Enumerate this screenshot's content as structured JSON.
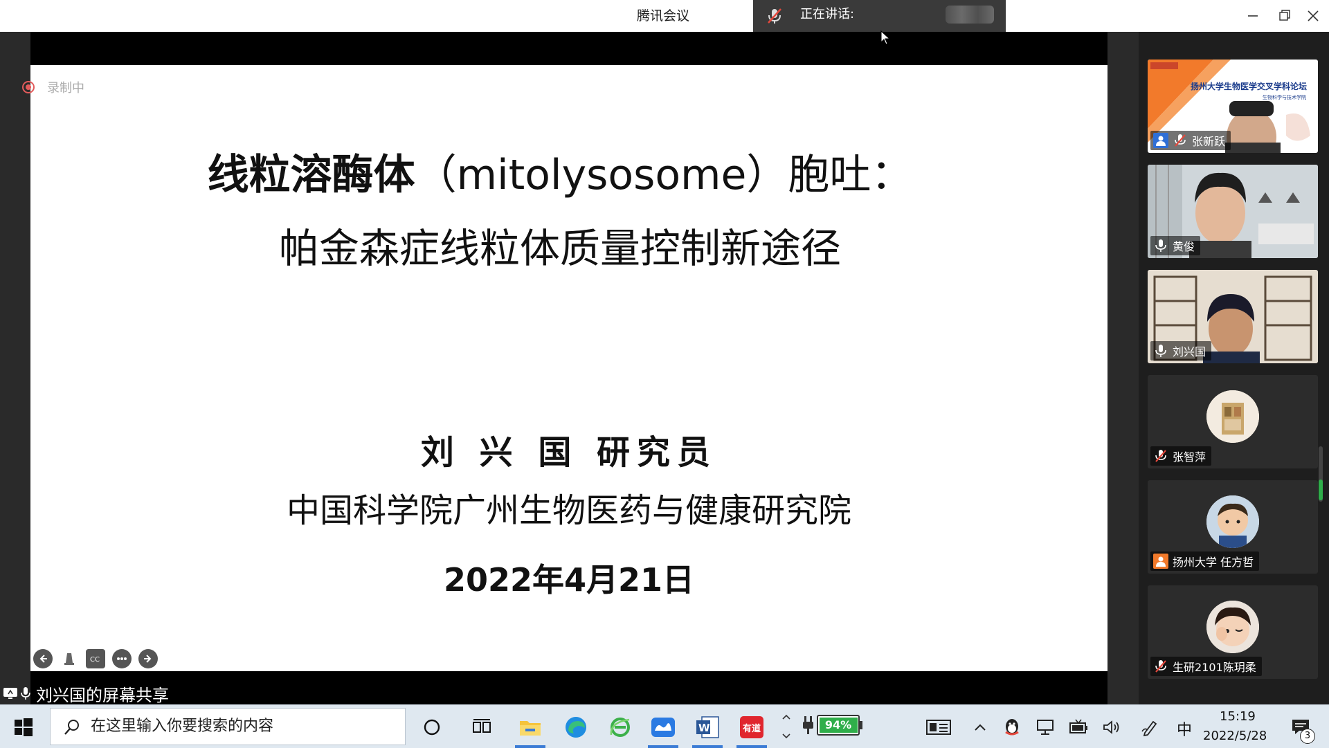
{
  "window": {
    "app_title": "腾讯会议",
    "speaking_label": "正在讲话:"
  },
  "recording": {
    "label": "录制中"
  },
  "slide": {
    "title_bold": "线粒溶酶体",
    "title_rest": "（mitolysosome）胞吐：",
    "subtitle": "帕金森症线粒体质量控制新途径",
    "author": "刘 兴 国  研究员",
    "institution": "中国科学院广州生物医药与健康研究院",
    "date": "2022年4月21日"
  },
  "share": {
    "label": "刘兴国的屏幕共享"
  },
  "participants": [
    {
      "name": "张新跃",
      "banner_title": "扬州大学生物医学交叉学科论坛",
      "banner_sub": "生物科学与技术学院",
      "mic": "muted"
    },
    {
      "name": "黄俊",
      "mic": "on"
    },
    {
      "name": "刘兴国",
      "mic": "on"
    },
    {
      "name": "张智萍",
      "mic": "muted"
    },
    {
      "name": "扬州大学 任方哲",
      "mic": "none"
    },
    {
      "name": "生研2101陈玥柔",
      "mic": "muted"
    }
  ],
  "taskbar": {
    "search_placeholder": "在这里输入你要搜索的内容",
    "battery": "94%",
    "ime": "中",
    "time": "15:19",
    "date": "2022/5/28",
    "notification_count": "3",
    "youdao_label": "有道"
  },
  "colors": {
    "accent_orange": "#f27a2b",
    "muted_red": "#e5483c",
    "taskbar_bg": "#dfe8f0",
    "battery_green": "#2fae4a"
  }
}
